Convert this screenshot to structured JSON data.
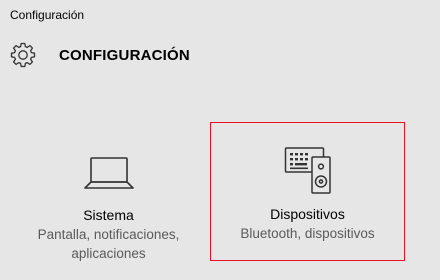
{
  "window": {
    "title": "Configuración"
  },
  "header": {
    "icon": "gear-icon",
    "title": "CONFIGURACIÓN"
  },
  "tiles": [
    {
      "icon": "laptop-icon",
      "name": "Sistema",
      "description": "Pantalla, notificaciones, aplicaciones"
    },
    {
      "icon": "devices-icon",
      "name": "Dispositivos",
      "description": "Bluetooth, dispositivos",
      "highlighted": true
    }
  ],
  "colors": {
    "background": "#e6e6e6",
    "highlight_border": "#e81123",
    "secondary_text": "#5a5a5a"
  }
}
